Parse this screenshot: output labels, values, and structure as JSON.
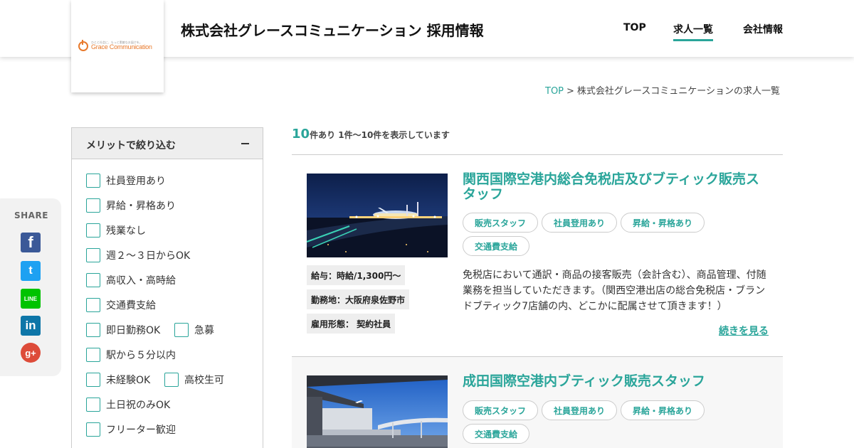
{
  "header": {
    "logo_tagline": "ひとと社会に、もっと素敵なお届けを。",
    "logo_name": "Grace Communication",
    "site_title": "株式会社グレースコミュニケーション 採用情報",
    "nav": [
      {
        "label": "TOP"
      },
      {
        "label": "求人一覧"
      },
      {
        "label": "会社情報"
      }
    ]
  },
  "breadcrumb": {
    "home": "TOP",
    "separator": ">",
    "current": "株式会社グレースコミュニケーションの求人一覧"
  },
  "share": {
    "label": "SHARE",
    "icons": [
      "facebook-icon",
      "twitter-icon",
      "line-icon",
      "linkedin-icon",
      "google-plus-icon"
    ],
    "glyphs": {
      "facebook": "f",
      "twitter": "t",
      "line": "LINE",
      "linkedin": "in",
      "google": "g+"
    }
  },
  "filter": {
    "title": "メリットで絞り込む",
    "options": [
      "社員登用あり",
      "昇給・昇格あり",
      "残業なし",
      "週２〜３日からOK",
      "高収入・高時給",
      "交通費支給",
      "即日勤務OK",
      "急募",
      "駅から５分以内",
      "未経験OK",
      "高校生可",
      "土日祝のみOK",
      "フリーター歓迎"
    ]
  },
  "results": {
    "count": "10",
    "count_suffix": "件あり 1件〜10件を表示しています"
  },
  "jobs": [
    {
      "title": "関西国際空港内総合免税店及びブティック販売スタッフ",
      "tags": [
        "販売スタッフ",
        "社員登用あり",
        "昇給・昇格あり",
        "交通費支給"
      ],
      "salary": "給与：時給/1,300円〜",
      "location": "勤務地：大阪府泉佐野市",
      "employment": "雇用形態： 契約社員",
      "description": "免税店において通訳・商品の接客販売（会計含む）、商品管理、付随業務を担当していただきます。（関西空港出店の総合免税店・ブランドブティック7店舗の内、どこかに配属させて頂きます！）",
      "more": "続きを見る"
    },
    {
      "title": "成田国際空港内ブティック販売スタッフ",
      "tags": [
        "販売スタッフ",
        "社員登用あり",
        "昇給・昇格あり",
        "交通費支給"
      ]
    }
  ],
  "colors": {
    "accent": "#2aa59a",
    "logo": "#e8792b"
  }
}
